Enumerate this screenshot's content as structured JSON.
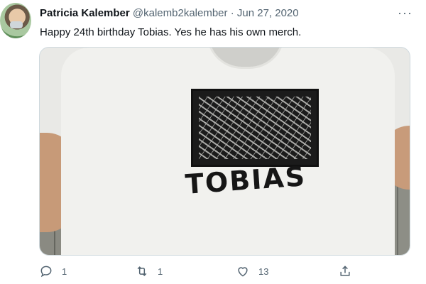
{
  "tweet": {
    "author_name": "Patricia Kalember",
    "handle": "@kalemb2kalember",
    "separator": "·",
    "date": "Jun 27, 2020",
    "more": "···",
    "text": "Happy 24th birthday Tobias. Yes he has his own merch."
  },
  "media": {
    "shirt_print_text": "TOBIAS"
  },
  "actions": {
    "replies": "1",
    "retweets": "1",
    "likes": "13"
  },
  "icons": {
    "reply": "reply-icon",
    "retweet": "retweet-icon",
    "like": "heart-icon",
    "share": "share-icon"
  }
}
